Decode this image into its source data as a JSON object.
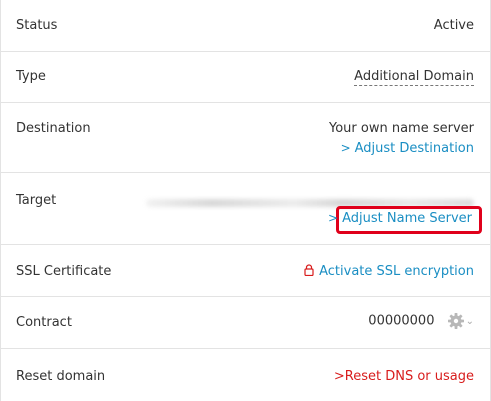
{
  "rows": {
    "status": {
      "label": "Status",
      "value": "Active"
    },
    "type": {
      "label": "Type",
      "value": "Additional Domain"
    },
    "destination": {
      "label": "Destination",
      "value": "Your own name server",
      "link": "Adjust Destination"
    },
    "target": {
      "label": "Target",
      "link": "Adjust Name Server"
    },
    "ssl": {
      "label": "SSL Certificate",
      "link": "Activate SSL encryption"
    },
    "contract": {
      "label": "Contract",
      "value": "00000000"
    },
    "reset": {
      "label": "Reset domain",
      "link": "Reset DNS or usage"
    }
  },
  "colors": {
    "link": "#1a8ec3",
    "danger": "#d81c1c",
    "highlight": "#e0001b"
  },
  "icons": {
    "chevron": "chevron-right-icon",
    "lock": "lock-icon",
    "gear": "gear-icon",
    "caret": "caret-down-icon"
  }
}
